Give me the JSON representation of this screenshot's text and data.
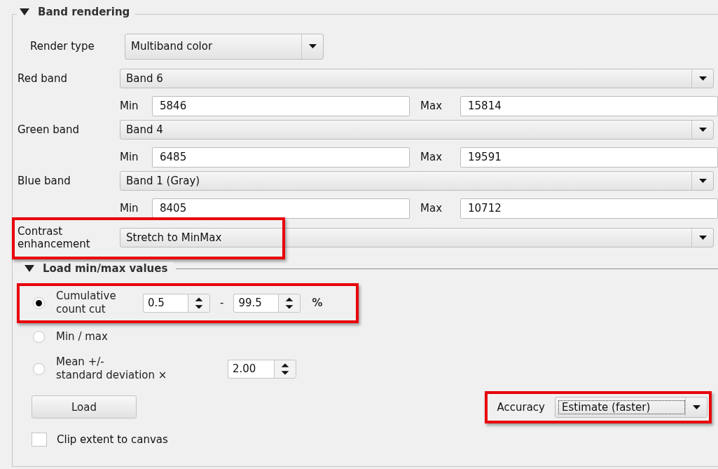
{
  "band_rendering": {
    "title": "Band rendering",
    "expanded": true,
    "render_type": {
      "label": "Render type",
      "value": "Multiband color"
    },
    "bands": [
      {
        "label": "Red band",
        "value": "Band 6",
        "min_label": "Min",
        "min": "5846",
        "max_label": "Max",
        "max": "15814"
      },
      {
        "label": "Green band",
        "value": "Band 4",
        "min_label": "Min",
        "min": "6485",
        "max_label": "Max",
        "max": "19591"
      },
      {
        "label": "Blue band",
        "value": "Band 1 (Gray)",
        "min_label": "Min",
        "min": "8405",
        "max_label": "Max",
        "max": "10712"
      }
    ],
    "contrast": {
      "label_lines": [
        "Contrast",
        "enhancement"
      ],
      "value": "Stretch to MinMax",
      "highlighted": true
    }
  },
  "load_minmax": {
    "title": "Load min/max values",
    "expanded": true,
    "options": [
      {
        "kind": "range",
        "label_lines": [
          "Cumulative",
          "count cut"
        ],
        "selected": true,
        "low": "0.5",
        "separator": "-",
        "high": "99.5",
        "unit": "%",
        "highlighted": true
      },
      {
        "kind": "plain",
        "label_lines": [
          "Min / max"
        ],
        "selected": false
      },
      {
        "kind": "factor",
        "label_lines": [
          "Mean +/-",
          "standard deviation ×"
        ],
        "selected": false,
        "value": "2.00"
      }
    ],
    "load_button": "Load",
    "accuracy": {
      "label": "Accuracy",
      "value": "Estimate (faster)",
      "highlighted": true
    },
    "clip": {
      "label": "Clip extent to canvas",
      "checked": false
    }
  }
}
